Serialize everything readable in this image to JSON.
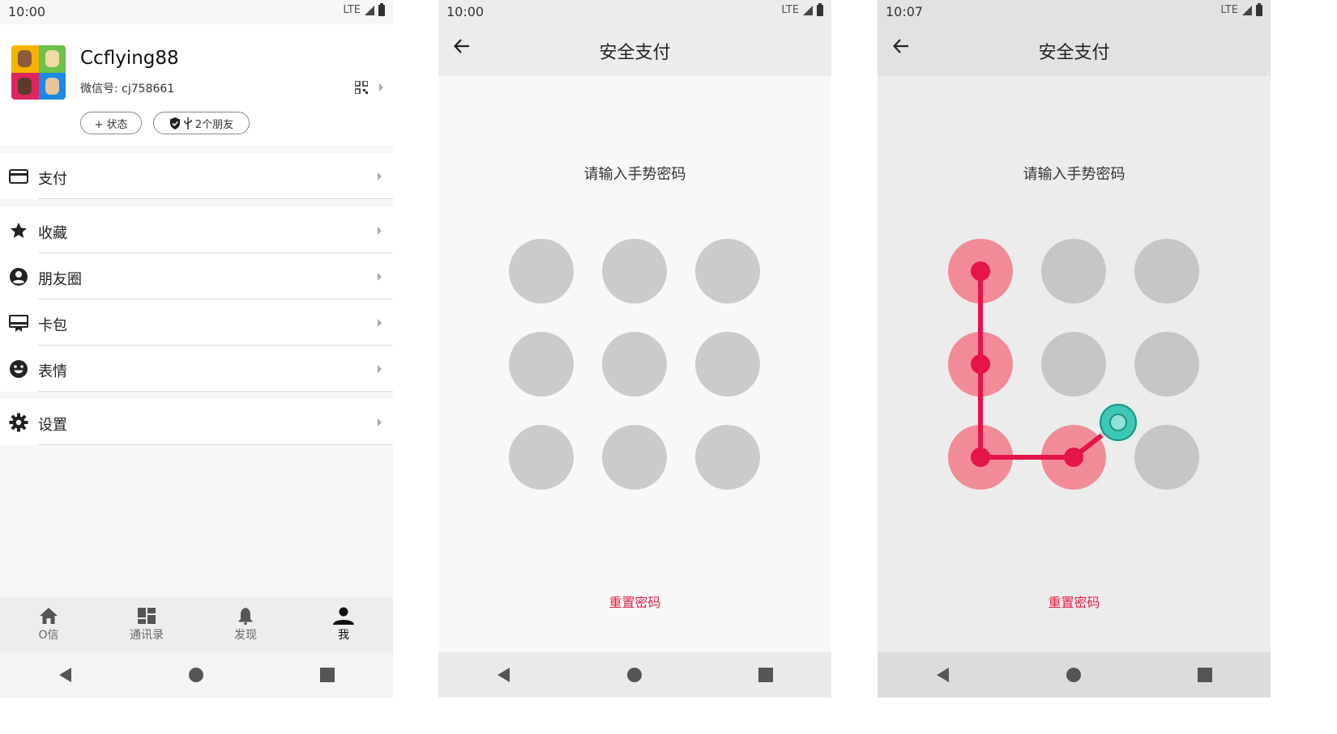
{
  "screen1": {
    "status": {
      "time": "10:00",
      "network": "LTE"
    },
    "profile": {
      "name": "Ccflying88",
      "wechat_id": "微信号: cj758661"
    },
    "pills": {
      "status": "+ 状态",
      "friends": "2个朋友"
    },
    "menu": [
      {
        "label": "支付",
        "icon": "card-icon"
      },
      {
        "label": "收藏",
        "icon": "star-icon"
      },
      {
        "label": "朋友圈",
        "icon": "account-circle-icon"
      },
      {
        "label": "卡包",
        "icon": "card-holder-icon"
      },
      {
        "label": "表情",
        "icon": "smiley-icon"
      },
      {
        "label": "设置",
        "icon": "gear-icon"
      }
    ],
    "tabs": [
      {
        "label": "O信",
        "icon": "home-icon"
      },
      {
        "label": "通讯录",
        "icon": "dashboard-icon"
      },
      {
        "label": "发现",
        "icon": "bell-icon"
      },
      {
        "label": "我",
        "icon": "person-icon",
        "active": true
      }
    ]
  },
  "screen2": {
    "status": {
      "time": "10:00",
      "network": "LTE"
    },
    "title": "安全支付",
    "prompt": "请输入手势密码",
    "reset": "重置密码"
  },
  "screen3": {
    "status": {
      "time": "10:07",
      "network": "LTE"
    },
    "title": "安全支付",
    "prompt": "请输入手势密码",
    "reset": "重置密码",
    "selected_dots": [
      1,
      4,
      7,
      8
    ]
  },
  "colors": {
    "accent": "#e8204a",
    "dot_idle": "#cbcbcb",
    "dot_selected": "#f28b98",
    "pointer": "#3cc8b4"
  }
}
